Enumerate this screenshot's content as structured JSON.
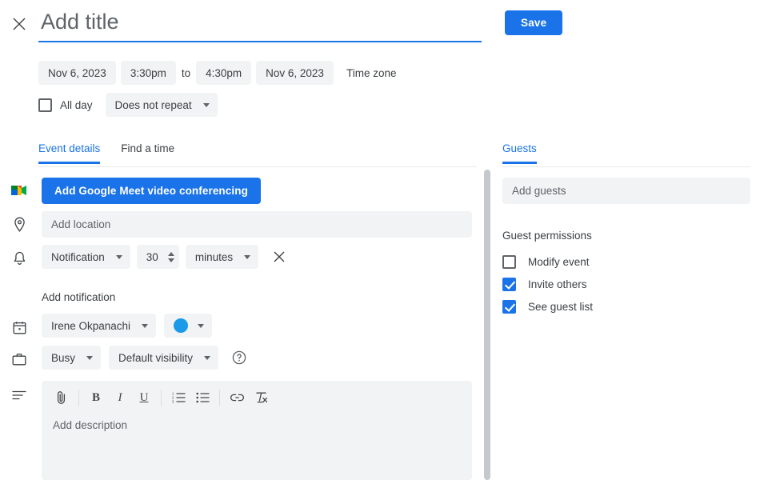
{
  "header": {
    "close_icon": "close-icon",
    "title_placeholder": "Add title",
    "title_value": "",
    "save_label": "Save"
  },
  "schedule": {
    "start_date": "Nov 6, 2023",
    "start_time": "3:30pm",
    "to_label": "to",
    "end_time": "4:30pm",
    "end_date": "Nov 6, 2023",
    "timezone_label": "Time zone",
    "all_day_label": "All day",
    "all_day_checked": false,
    "repeat_value": "Does not repeat"
  },
  "tabs": [
    {
      "label": "Event details",
      "active": true
    },
    {
      "label": "Find a time",
      "active": false
    }
  ],
  "event_details": {
    "meet_icon": "google-meet-icon",
    "meet_button_label": "Add Google Meet video conferencing",
    "location_icon": "location-pin-icon",
    "location_placeholder": "Add location",
    "location_value": "",
    "notification_icon": "bell-icon",
    "notification_type": "Notification",
    "notification_amount": "30",
    "notification_unit": "minutes",
    "remove_notification_icon": "close-icon",
    "add_notification_label": "Add notification",
    "calendar_icon": "calendar-icon",
    "calendar_owner": "Irene Okpanachi",
    "event_color": "#1a9ae8",
    "busy_icon": "briefcase-icon",
    "busy_value": "Busy",
    "visibility_value": "Default visibility",
    "help_icon": "help-circle-icon",
    "description_icon": "description-lines-icon",
    "description_placeholder": "Add description",
    "description_value": "",
    "toolbar": [
      {
        "icon": "attachment-icon",
        "label": "Attach file"
      },
      {
        "icon": "bold-icon",
        "label": "B"
      },
      {
        "icon": "italic-icon",
        "label": "I"
      },
      {
        "icon": "underline-icon",
        "label": "U"
      },
      {
        "icon": "numbered-list-icon",
        "label": "Numbered list"
      },
      {
        "icon": "bulleted-list-icon",
        "label": "Bulleted list"
      },
      {
        "icon": "link-icon",
        "label": "Insert link"
      },
      {
        "icon": "clear-formatting-icon",
        "label": "Remove formatting"
      }
    ]
  },
  "guests": {
    "tab_label": "Guests",
    "add_guests_placeholder": "Add guests",
    "add_guests_value": "",
    "permissions_title": "Guest permissions",
    "permissions": [
      {
        "label": "Modify event",
        "checked": false
      },
      {
        "label": "Invite others",
        "checked": true
      },
      {
        "label": "See guest list",
        "checked": true
      }
    ]
  },
  "colors": {
    "accent": "#1a73e8",
    "chip_bg": "#f1f3f4",
    "text": "#3c4043",
    "muted_text": "#5f6368",
    "scrollbar": "#c5c8cc"
  }
}
